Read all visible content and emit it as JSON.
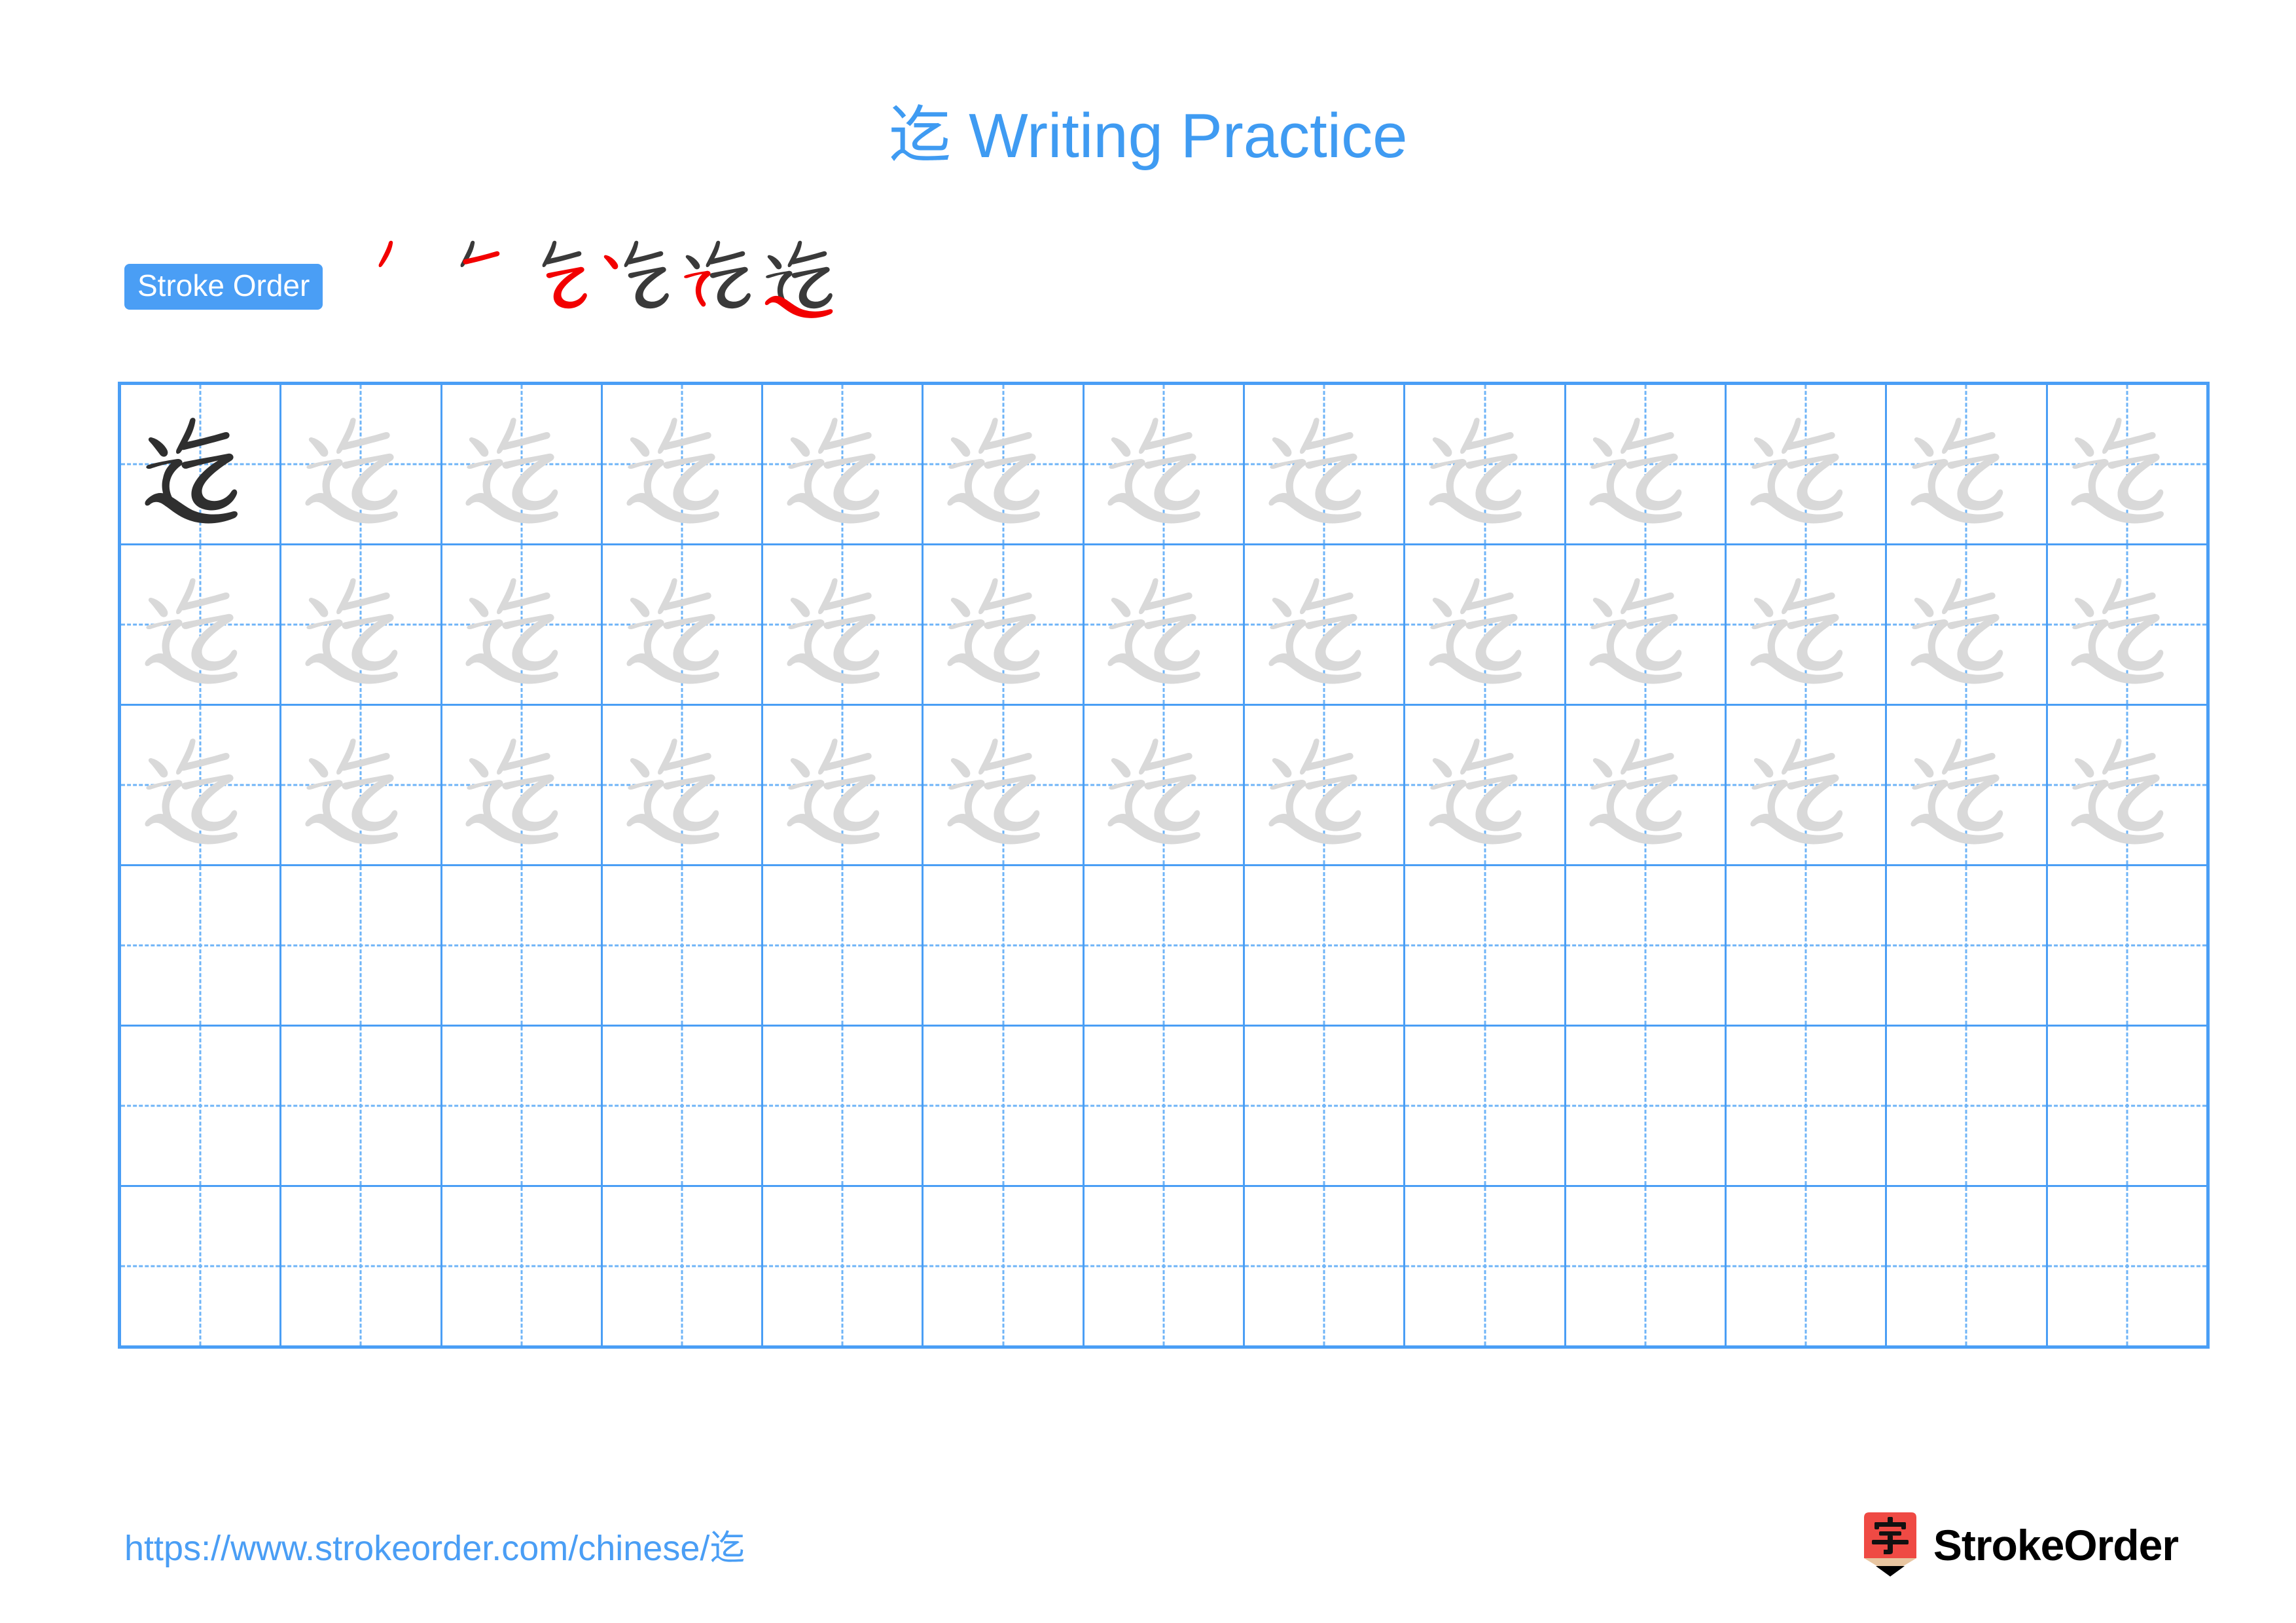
{
  "document": {
    "character": "迄",
    "title": "迄 Writing Practice",
    "page_background": "#ffffff",
    "accent_blue": "#4a9ef5",
    "title_blue": "#3f9bf2",
    "new_stroke_red": "#f20000",
    "existing_stroke_gray": "#3a3a3a",
    "trace_gray": "#d9d9d9",
    "ink_black": "#2f2f2f"
  },
  "stroke_order": {
    "badge_label": "Stroke Order",
    "total_strokes": 6,
    "steps": [
      {
        "index": 1,
        "new_stroke_name": "pie",
        "strokes_drawn": 1
      },
      {
        "index": 2,
        "new_stroke_name": "heng",
        "strokes_drawn": 2
      },
      {
        "index": 3,
        "new_stroke_name": "heng-zhe-wan-gou",
        "strokes_drawn": 3
      },
      {
        "index": 4,
        "new_stroke_name": "dian",
        "strokes_drawn": 4
      },
      {
        "index": 5,
        "new_stroke_name": "heng-zhe-zhe-pie",
        "strokes_drawn": 5
      },
      {
        "index": 6,
        "new_stroke_name": "ping-na",
        "strokes_drawn": 6
      }
    ]
  },
  "practice_grid": {
    "columns": 13,
    "rows": 6,
    "guide_style": "dashed-cross",
    "cells": [
      [
        "ink",
        "trace",
        "trace",
        "trace",
        "trace",
        "trace",
        "trace",
        "trace",
        "trace",
        "trace",
        "trace",
        "trace",
        "trace"
      ],
      [
        "trace",
        "trace",
        "trace",
        "trace",
        "trace",
        "trace",
        "trace",
        "trace",
        "trace",
        "trace",
        "trace",
        "trace",
        "trace"
      ],
      [
        "trace",
        "trace",
        "trace",
        "trace",
        "trace",
        "trace",
        "trace",
        "trace",
        "trace",
        "trace",
        "trace",
        "trace",
        "trace"
      ],
      [
        "empty",
        "empty",
        "empty",
        "empty",
        "empty",
        "empty",
        "empty",
        "empty",
        "empty",
        "empty",
        "empty",
        "empty",
        "empty"
      ],
      [
        "empty",
        "empty",
        "empty",
        "empty",
        "empty",
        "empty",
        "empty",
        "empty",
        "empty",
        "empty",
        "empty",
        "empty",
        "empty"
      ],
      [
        "empty",
        "empty",
        "empty",
        "empty",
        "empty",
        "empty",
        "empty",
        "empty",
        "empty",
        "empty",
        "empty",
        "empty",
        "empty"
      ]
    ]
  },
  "footer": {
    "url": "https://www.strokeorder.com/chinese/迄",
    "brand_name": "StrokeOrder",
    "logo_character": "字",
    "logo_red": "#ef4a44",
    "logo_tan": "#e8c5a0"
  }
}
